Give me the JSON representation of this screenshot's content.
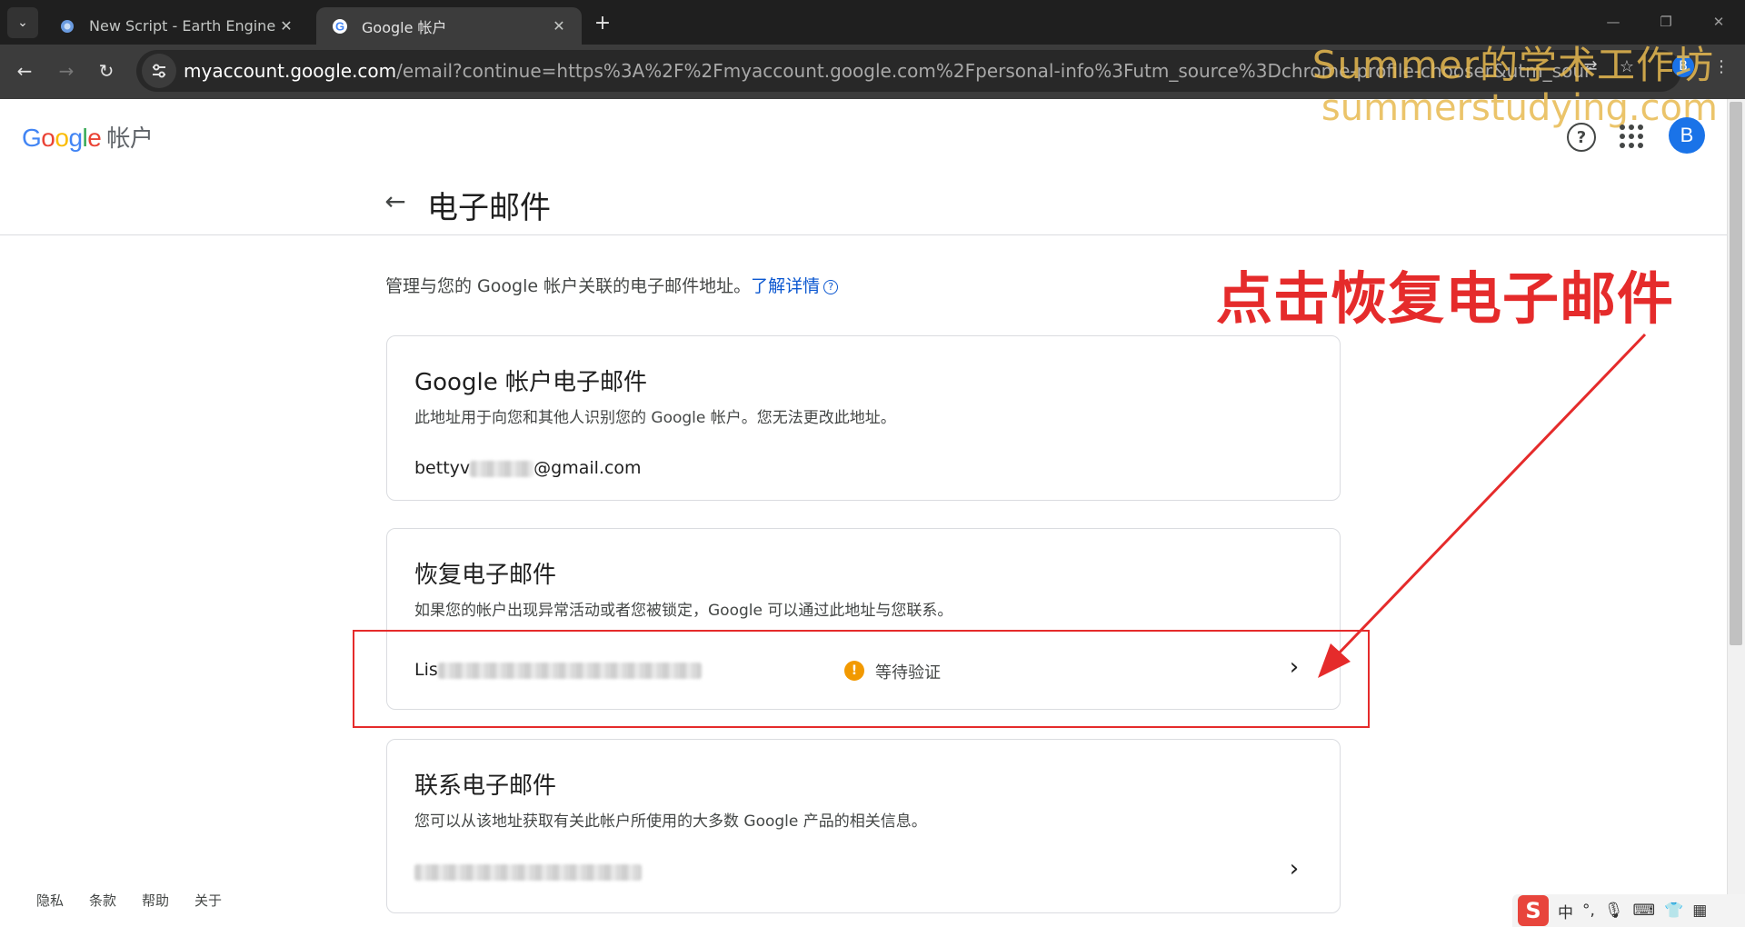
{
  "browser": {
    "tab_list_icon": "chevron-down-icon",
    "tabs": [
      {
        "title": "New Script - Earth Engine Co",
        "favicon": "earth-engine-icon"
      },
      {
        "title": "Google 帐户",
        "favicon": "google-g-icon"
      }
    ],
    "url_host": "myaccount.google.com",
    "url_path": "/email?continue=https%3A%2F%2Fmyaccount.google.com%2Fpersonal-info%3Futm_source%3Dchrome-profile-chooser&utm_source=chrome-profile-choo..."
  },
  "watermark": {
    "line1": "Summer的学术工作坊",
    "line2": "summerstudying.com"
  },
  "header": {
    "logo_text": "Google",
    "logo_suffix": "帐户",
    "avatar_letter": "B"
  },
  "page": {
    "title": "电子邮件",
    "intro": "管理与您的 Google 帐户关联的电子邮件地址。",
    "learn_more": "了解详情"
  },
  "cards": {
    "account": {
      "title": "Google 帐户电子邮件",
      "desc": "此地址用于向您和其他人识别您的 Google 帐户。您无法更改此地址。",
      "value_prefix": "bettyv",
      "value_suffix": "@gmail.com"
    },
    "recovery": {
      "title": "恢复电子邮件",
      "desc": "如果您的帐户出现异常活动或者您被锁定，Google 可以通过此地址与您联系。",
      "value_prefix": "Lis",
      "status": "等待验证"
    },
    "contact": {
      "title": "联系电子邮件",
      "desc": "您可以从该地址获取有关此帐户所使用的大多数 Google 产品的相关信息。"
    }
  },
  "annotation": {
    "text": "点击恢复电子邮件",
    "color": "#e52b2b"
  },
  "footer": {
    "links": [
      "隐私",
      "条款",
      "帮助",
      "关于"
    ]
  },
  "ime": {
    "mode": "中",
    "punct": "°,"
  }
}
